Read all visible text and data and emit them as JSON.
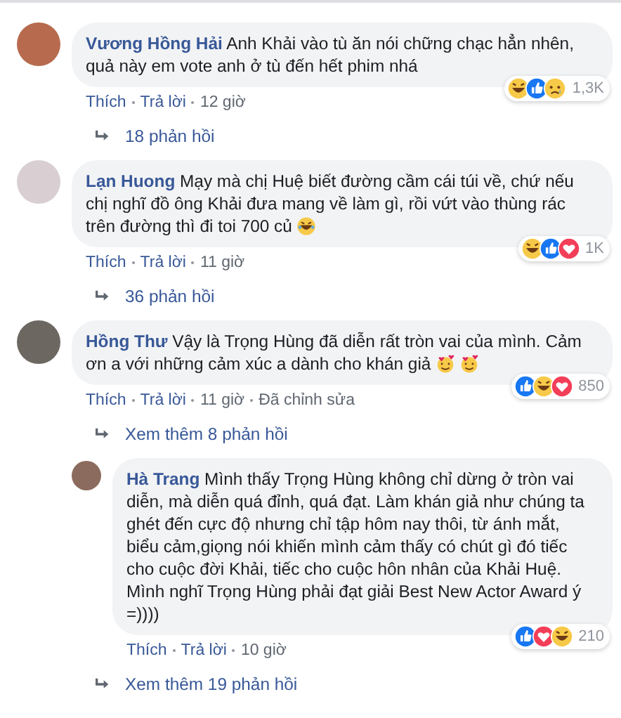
{
  "comments": [
    {
      "author": "Vương Hồng Hải",
      "text": "Anh Khải vào tù ăn nói chững chạc hẳn nhên, quả này em vote anh ở tù đến hết phim nhá",
      "reactions": [
        {
          "kind": "haha"
        },
        {
          "kind": "like"
        },
        {
          "kind": "sad"
        }
      ],
      "reaction_count": "1,3K",
      "actions": [
        "Thích",
        "Trả lời",
        "12 giờ"
      ],
      "thread": [
        {
          "kind": "link",
          "label": "18 phản hồi"
        }
      ]
    },
    {
      "author": "Lạn Huong",
      "text": "Mạy mà chị Huệ biết đường cầm cái túi về, chứ nếu chị nghĩ đồ ông Khải đưa mang về làm gì, rồi vứt vào thùng rác trên đường thì đi toi 700 củ",
      "emojis": [
        {
          "kind": "laugh"
        }
      ],
      "reactions": [
        {
          "kind": "haha"
        },
        {
          "kind": "like"
        },
        {
          "kind": "love"
        }
      ],
      "reaction_count": "1K",
      "actions": [
        "Thích",
        "Trả lời",
        "11 giờ"
      ],
      "thread": [
        {
          "kind": "link",
          "label": "36 phản hồi"
        }
      ]
    },
    {
      "author": "Hồng Thư",
      "text": "Vậy là Trọng Hùng đã diễn rất tròn vai của mình. Cảm ơn a với những cảm xúc a dành cho khán giả",
      "emojis": [
        {
          "kind": "love"
        },
        {
          "kind": "love"
        }
      ],
      "reactions": [
        {
          "kind": "like"
        },
        {
          "kind": "haha"
        },
        {
          "kind": "love"
        }
      ],
      "reaction_count": "850",
      "actions": [
        "Thích",
        "Trả lời",
        "11 giờ",
        "Đã chỉnh sửa"
      ],
      "thread": [
        {
          "kind": "link",
          "label": "Xem thêm 8 phản hồi"
        },
        {
          "kind": "reply",
          "author": "Hà Trang",
          "text": "Mình thấy Trọng Hùng không chỉ dừng ở tròn vai diễn, mà diễn quá đỉnh, quá đạt. Làm khán giả như chúng ta ghét đến cực độ nhưng chỉ tập hôm nay thôi, từ ánh mắt, biểu cảm,giọng nói khiến mình cảm thấy có chút gì đó tiếc cho cuộc đời Khải, tiếc cho cuộc hôn nhân của Khải Huệ. Mình nghĩ Trọng Hùng phải đạt giải Best New Actor Award ý =))))",
          "reactions": [
            {
              "kind": "like"
            },
            {
              "kind": "love"
            },
            {
              "kind": "haha"
            }
          ],
          "reaction_count": "210",
          "actions": [
            "Thích",
            "Trả lời",
            "10 giờ"
          ]
        },
        {
          "kind": "link",
          "label": "Xem thêm 19 phản hồi"
        }
      ]
    }
  ]
}
